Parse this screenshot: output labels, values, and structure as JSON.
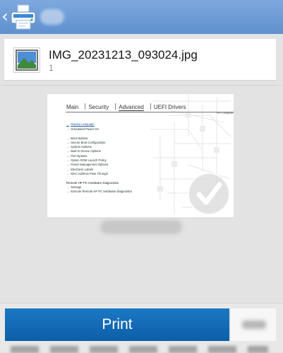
{
  "header": {
    "back_icon": "chevron-left-icon",
    "app_icon": "printer-icon"
  },
  "file": {
    "name": "IMG_20231213_093024.jpg",
    "count": "1",
    "thumbnail_icon": "image-icon"
  },
  "preview": {
    "tabs": [
      "Main",
      "Security",
      "Advanced",
      "UEFI Drivers"
    ],
    "active_tab": "Advanced",
    "brand": "HP Computer",
    "items": [
      "Display Language",
      "Scheduled Power-On",
      "Boot Options",
      "Secure Boot Configuration",
      "System Options",
      "Built-In Device Options",
      "Port Options",
      "Option ROM Launch Policy",
      "Power Management Options",
      "Electronic Labels",
      "MAC Address Pass Through"
    ],
    "remote_heading": "Remote HP PC Hardware Diagnostics",
    "remote_items": [
      "Settings",
      "Execute Remote HP PC Hardware Diagnostics"
    ],
    "check_icon": "checkmark-icon"
  },
  "actions": {
    "print_label": "Print",
    "settings_icon": "settings-icon"
  },
  "colors": {
    "topbar": "#6f9ed8",
    "print_button": "#1468b6",
    "link": "#2a5fa8"
  }
}
